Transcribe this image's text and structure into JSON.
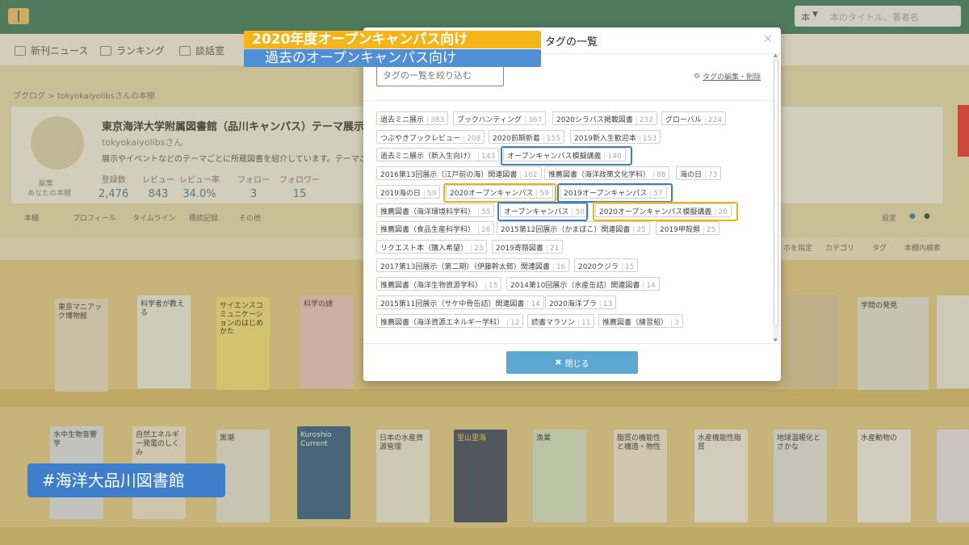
{
  "topbar": {
    "search_select": "本",
    "search_placeholder": "本のタイトル、著者名"
  },
  "nav": {
    "items": [
      {
        "label": "新刊ニュース"
      },
      {
        "label": "ランキング"
      },
      {
        "label": "談話室"
      }
    ]
  },
  "breadcrumb": "ブクログ > tokyokaiyolibsさんの本棚",
  "profile": {
    "title": "東京海洋大学附属図書館（品川キャンパス）テーマ展示",
    "username": "tokyokaiyolibsさん",
    "description": "展示やイベントなどのテーマごとに所蔵図書を紹介しています。テーマごとにタグを",
    "avatar_caption": "編集",
    "avatar_sub": "あなたの本棚",
    "stats": [
      {
        "label": "登録数",
        "value": "2,476"
      },
      {
        "label": "レビュー",
        "value": "843"
      },
      {
        "label": "レビュー率",
        "value": "34.0%"
      },
      {
        "label": "フォロー",
        "value": "3"
      },
      {
        "label": "フォロワー",
        "value": "15"
      }
    ]
  },
  "subnav": {
    "items": [
      "本棚",
      "プロフィール",
      "タイムライン",
      "積読記録",
      "その他"
    ],
    "right": "設定"
  },
  "shelf_toolbar": {
    "items": [
      "ホを指定",
      "カテゴリ",
      "タグ",
      "本棚内検索"
    ]
  },
  "books": {
    "row1": [
      "東京マニアック博物館",
      "科学者が教える",
      "サイエンスコミュニケーションのはじめかた",
      "科学の謎",
      "学問の発見"
    ],
    "row2": [
      "水中生物音響学",
      "自然エネルギー発電のしくみ",
      "黒潮",
      "Kuroshio Current",
      "日本の水産資源管理",
      "里山里海",
      "漁業",
      "脂質の機能性と構造・物性",
      "水産機能性脂質",
      "地球温暖化とさかな",
      "水産動物の"
    ]
  },
  "modal": {
    "title": "タグの一覧",
    "close_x": "×",
    "filter_placeholder": "タグの一覧を絞り込む",
    "edit_link": "タグの編集・削除",
    "close_button": "閉じる",
    "tags": [
      {
        "name": "過去ミニ展示",
        "count": "383"
      },
      {
        "name": "ブックハンティング",
        "count": "367"
      },
      {
        "name": "2020シラバス掲載図書",
        "count": "232"
      },
      {
        "name": "グローバル",
        "count": "224"
      },
      {
        "name": "つぶやきブックレビュー",
        "count": "208"
      },
      {
        "name": "2020前期新着",
        "count": "155"
      },
      {
        "name": "2019新入生歓迎本",
        "count": "153"
      },
      {
        "name": "過去ミニ展示（新入生向け）",
        "count": "143"
      },
      {
        "name": "オープンキャンパス模擬講義",
        "count": "140"
      },
      {
        "name": "2016第13回展示（江戸前の海）関連図書",
        "count": "102"
      },
      {
        "name": "推薦図書（海洋政策文化学科）",
        "count": "88"
      },
      {
        "name": "海の日",
        "count": "73"
      },
      {
        "name": "2019海の日",
        "count": "59"
      },
      {
        "name": "2020オープンキャンパス",
        "count": "59"
      },
      {
        "name": "2019オープンキャンパス",
        "count": "57"
      },
      {
        "name": "推薦図書（海洋環境科学科）",
        "count": "55"
      },
      {
        "name": "オープンキャンパス",
        "count": "50"
      },
      {
        "name": "2020オープンキャンパス模擬講義",
        "count": "26"
      },
      {
        "name": "推薦図書（食品生産科学科）",
        "count": "26"
      },
      {
        "name": "2015第12回展示（かまぼこ）関連図書",
        "count": "25"
      },
      {
        "name": "2019甲殻類",
        "count": "25"
      },
      {
        "name": "リクエスト本（購入希望）",
        "count": "23"
      },
      {
        "name": "2019寄贈図書",
        "count": "21"
      },
      {
        "name": "2017第13回展示（第二期）（伊藤幹太郎）関連図書",
        "count": "16"
      },
      {
        "name": "2020クジラ",
        "count": "15"
      },
      {
        "name": "推薦図書（海洋生物資源学科）",
        "count": "15"
      },
      {
        "name": "2014第10回展示（水産缶詰）関連図書",
        "count": "14"
      },
      {
        "name": "2015第11回展示（サケ中骨缶詰）関連図書",
        "count": "14"
      },
      {
        "name": "2020海洋プラ",
        "count": "13"
      },
      {
        "name": "推薦図書（海洋資源エネルギー学科）",
        "count": "12"
      },
      {
        "name": "読書マラソン",
        "count": "11"
      },
      {
        "name": "推薦図書（練習船）",
        "count": "3"
      }
    ]
  },
  "annotations": {
    "legend_current": "2020年度オープンキャンパス向け",
    "legend_past": "過去のオープンキャンパス向け",
    "hashtag": "#海洋大品川図書館",
    "current_color": "#f2b20e",
    "past_color": "#3f7ec9"
  }
}
